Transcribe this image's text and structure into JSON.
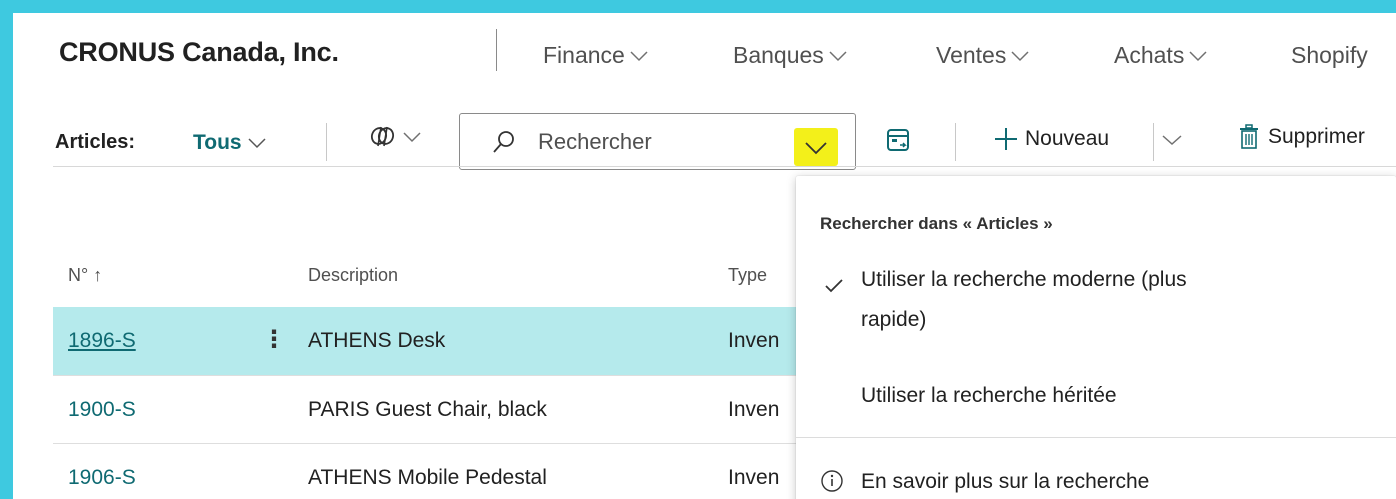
{
  "company": "CRONUS Canada, Inc.",
  "nav": [
    "Finance",
    "Banques",
    "Ventes",
    "Achats",
    "Shopify"
  ],
  "toolbar": {
    "page_label": "Articles:",
    "view": "Tous",
    "search_placeholder": "Rechercher",
    "new_label": "Nouveau",
    "delete_label": "Supprimer"
  },
  "columns": {
    "no": "N° ↑",
    "description": "Description",
    "type": "Type"
  },
  "rows": [
    {
      "no": "1896-S",
      "description": "ATHENS Desk",
      "type": "Inven"
    },
    {
      "no": "1900-S",
      "description": "PARIS Guest Chair, black",
      "type": "Inven"
    },
    {
      "no": "1906-S",
      "description": "ATHENS Mobile Pedestal",
      "type": "Inven"
    }
  ],
  "dropdown": {
    "title": "Rechercher dans « Articles »",
    "option_modern_line1": "Utiliser la recherche moderne (plus",
    "option_modern_line2": "rapide)",
    "option_legacy": "Utiliser la recherche héritée",
    "learn_more": "En savoir plus sur la recherche"
  },
  "colors": {
    "accent": "#0f6a72",
    "selected_row": "#b5eaec",
    "highlight": "#f3f01a",
    "background": "#3ec9e0"
  }
}
